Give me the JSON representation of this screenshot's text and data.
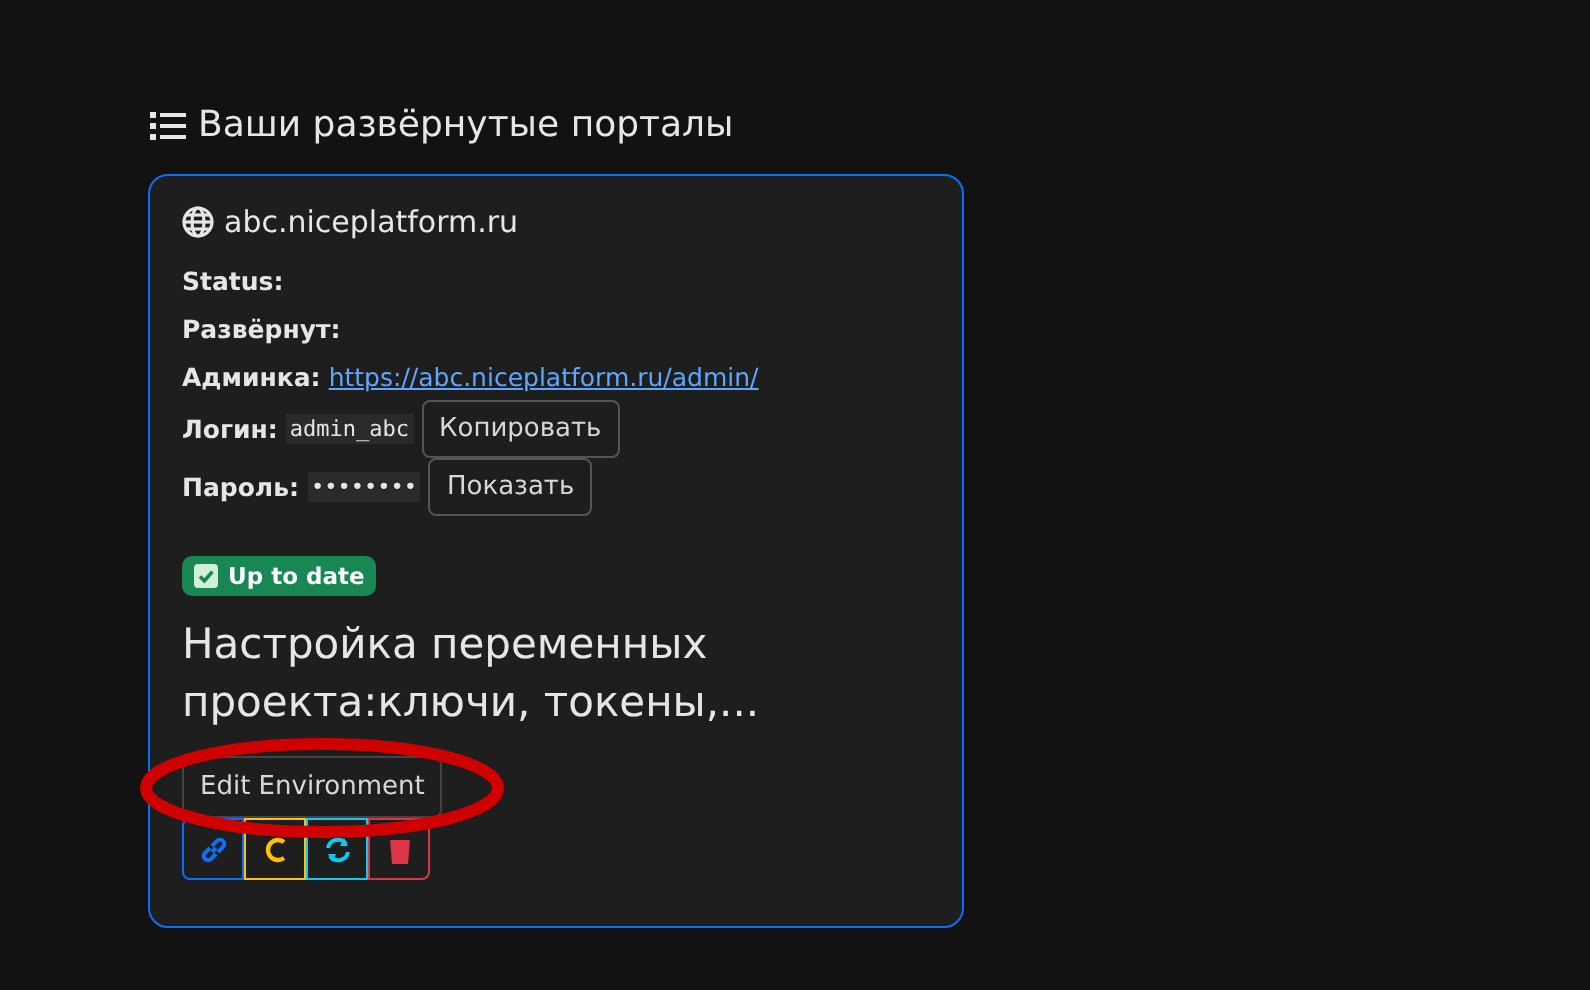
{
  "heading": "Ваши развёрнутые порталы",
  "portal": {
    "domain": "abc.niceplatform.ru",
    "fields": [
      {
        "kind": "plain",
        "label": "Status:"
      },
      {
        "kind": "plain",
        "label": "Развёрнут:"
      },
      {
        "kind": "link",
        "label": "Админка:",
        "value": "https://abc.niceplatform.ru/admin/"
      },
      {
        "kind": "code",
        "label": "Логин:",
        "value": "admin_abc",
        "button": "Копировать"
      },
      {
        "kind": "code",
        "label": "Пароль:",
        "value": "••••••••",
        "button": "Показать"
      }
    ],
    "badge": "Up to date",
    "description": "Настройка переменных проекта:ключи, токены,...",
    "edit_button": "Edit Environment",
    "actions": [
      {
        "kind": "link",
        "color": "#0d6efd"
      },
      {
        "kind": "edit",
        "color": "#ffc107"
      },
      {
        "kind": "refresh",
        "color": "#0dcaf0"
      },
      {
        "kind": "delete",
        "color": "#dc3545"
      }
    ]
  }
}
